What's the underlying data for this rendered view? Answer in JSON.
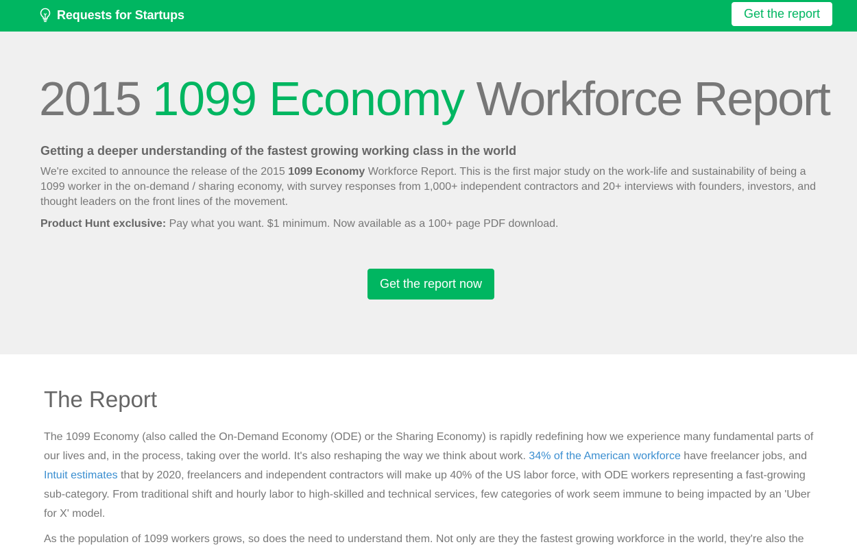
{
  "nav": {
    "brand": "Requests for Startups",
    "cta": "Get the report"
  },
  "hero": {
    "title_year": "2015",
    "title_highlight": "1099 Economy",
    "title_rest": "Workforce Report",
    "subtitle": "Getting a deeper understanding of the fastest growing working class in the world",
    "intro_before": "We're excited to announce the release of the 2015 ",
    "intro_bold": "1099 Economy",
    "intro_after": " Workforce Report. This is the first major study on the work-life and sustainability of being a 1099 worker in the on-demand / sharing economy, with survey responses from 1,000+ independent contractors and 20+ interviews with founders, investors, and thought leaders on the front lines of the movement.",
    "exclusive_label": "Product Hunt exclusive:",
    "exclusive_text": " Pay what you want. $1 minimum. Now available as a 100+ page PDF download.",
    "cta": "Get the report now"
  },
  "report": {
    "heading": "The Report",
    "p1_a": "The 1099 Economy (also called the On-Demand Economy (ODE) or the Sharing Economy) is rapidly redefining how we experience many fundamental parts of our lives and, in the process, taking over the world. It's also reshaping the way we think about work. ",
    "p1_link1": "34% of the American workforce",
    "p1_b": " have freelancer jobs, and ",
    "p1_link2": "Intuit estimates",
    "p1_c": " that by 2020, freelancers and independent contractors will make up 40% of the US labor force, with ODE workers representing a fast-growing sub-category. From traditional shift and hourly labor to high-skilled and technical services, few categories of work seem immune to being impacted by an 'Uber for X' model.",
    "p2": "As the population of 1099 workers grows, so does the need to understand them. Not only are they the fastest growing workforce in the world, they're also the"
  },
  "colors": {
    "brand_green": "#00b661",
    "link_blue": "#3a8ed0",
    "hero_bg": "#f0f0f0"
  },
  "icons": {
    "brand": "lightbulb-icon"
  }
}
